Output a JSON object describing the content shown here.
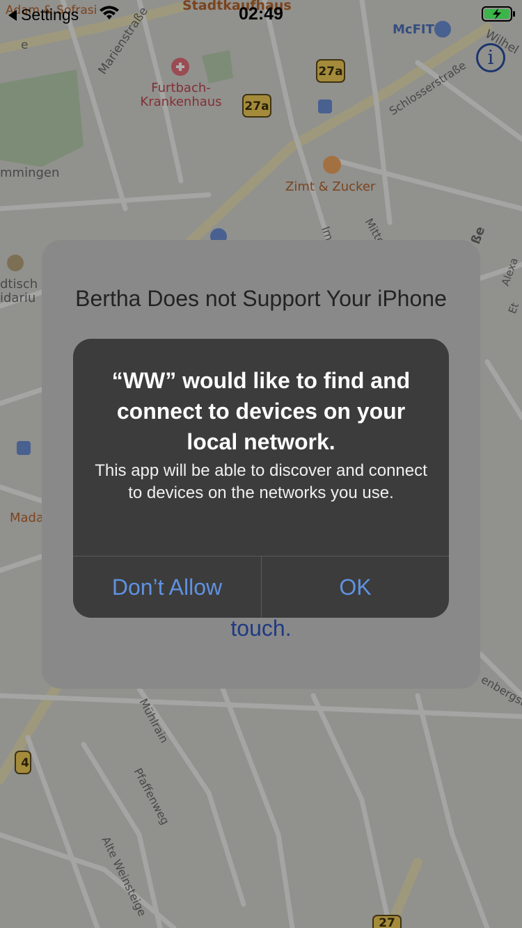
{
  "status_bar": {
    "back_label": "Settings",
    "time": "02:49"
  },
  "map": {
    "labels": {
      "stadtkaufhaus": "Stadtkaufhaus",
      "adam": "Adam & Sofrasi",
      "marienstrasse": "Marienstraße",
      "furtbach_1": "Furtbach-",
      "furtbach_2": "Krankenhaus",
      "mcfit": "McFIT",
      "wilhelm": "Wilhel",
      "schlosserstrasse": "Schlosserstraße",
      "mmingen": "mmingen",
      "zimt": "Zimt & Zucker",
      "mitte": "Mitte",
      "im": "Im",
      "sse": "ße",
      "dtisch": "dtisch",
      "idariu": "idariu",
      "alexa": "Alexa",
      "et": "Et",
      "mada": "Mada",
      "enbergst": "enbergst",
      "muehlrain": "Mühlrain",
      "pfaffenweg": "Pfaffenweg",
      "alte_weinsteige": "Alte Weinsteige",
      "e": "e"
    },
    "route_badges": {
      "badge_27a_top": "27a",
      "badge_27a_mid": "27a",
      "badge_27_bottom": "27",
      "badge_4": "4"
    }
  },
  "info_button": {
    "glyph": "i"
  },
  "background_alert": {
    "title": "Bertha Does not Support Your iPhone",
    "trailing_text": "touch."
  },
  "system_alert": {
    "title": "“WW” would like to find and connect to devices on your local network.",
    "message": "This app will be able to discover and connect to devices on the networks you use.",
    "dont_allow_label": "Don’t Allow",
    "ok_label": "OK"
  },
  "colors": {
    "accent": "#5f92e0",
    "alert_background": "#3c3c3c",
    "map_background": "#a4a4a4"
  }
}
